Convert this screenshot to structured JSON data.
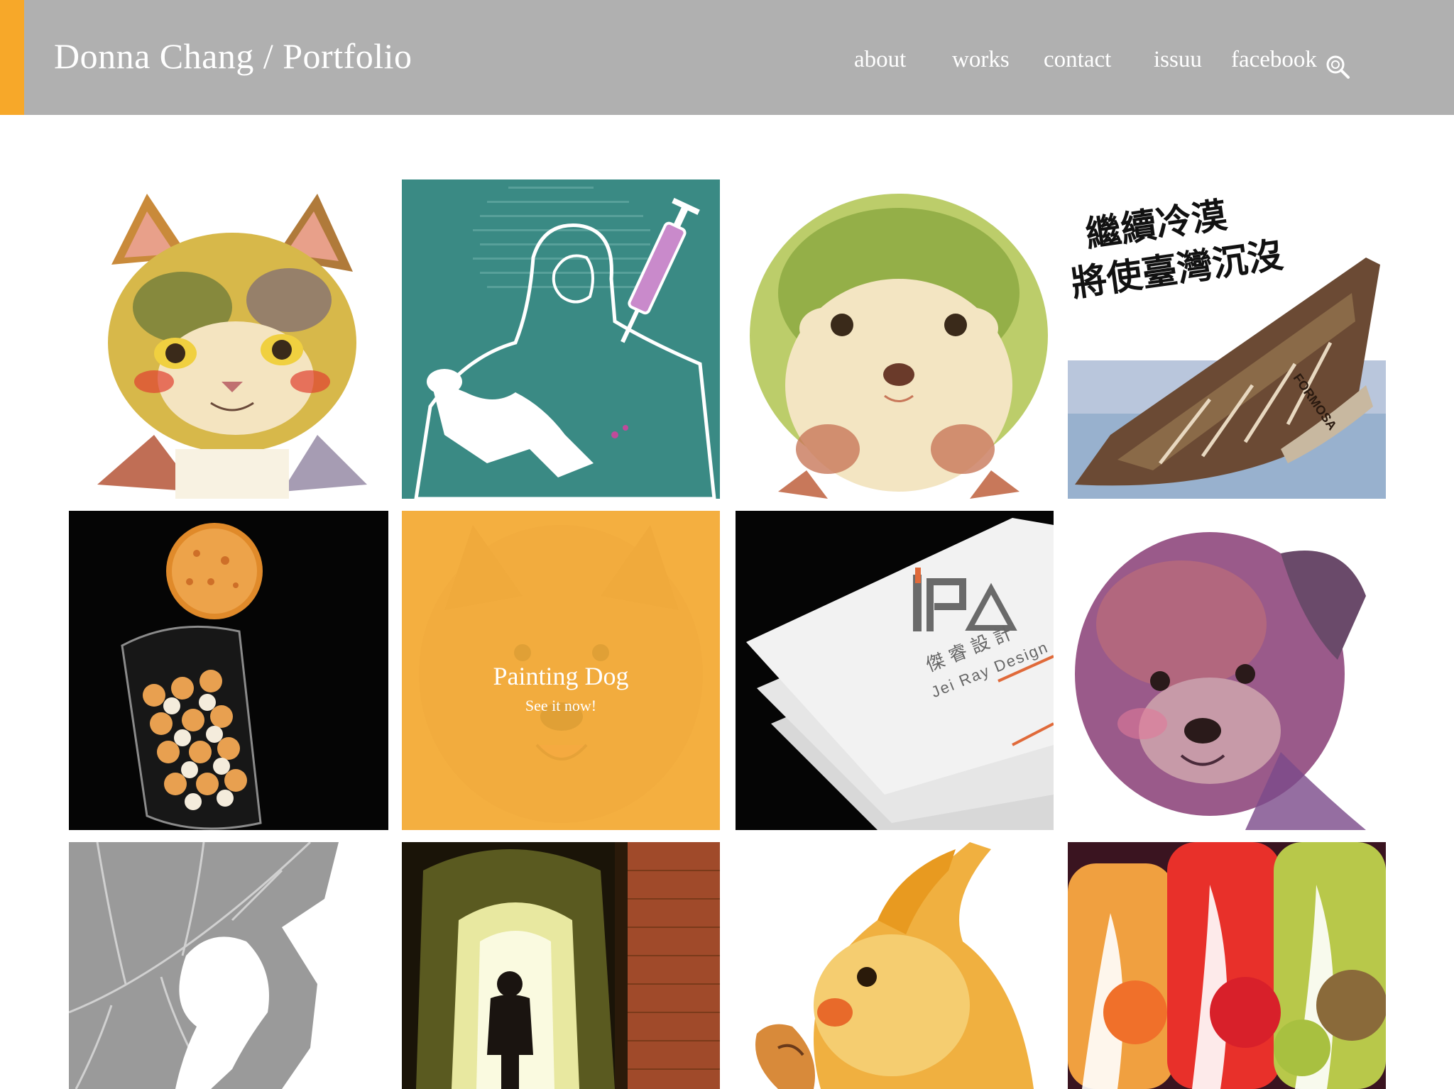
{
  "site": {
    "title": "Donna Chang / Portfolio",
    "accent_color": "#f7a829",
    "header_color": "#b0b0b0"
  },
  "nav": {
    "items": [
      {
        "label": "about"
      },
      {
        "label": "works"
      },
      {
        "label": "contact"
      },
      {
        "label": "issuu"
      },
      {
        "label": "facebook"
      }
    ],
    "search_icon": "search-icon"
  },
  "works": {
    "tiles": [
      {
        "name": "watercolor-cat",
        "subject": "cat"
      },
      {
        "name": "euthanasia-poster",
        "subject": "woman-with-dog-and-syringe"
      },
      {
        "name": "watercolor-hedgehog",
        "subject": "hedgehog"
      },
      {
        "name": "formosa-boat-poster",
        "subject": "sinking-boat",
        "headline_line1": "繼續冷漠",
        "headline_line2": "將使臺灣沉沒",
        "boat_label": "FORMOSA"
      },
      {
        "name": "rice-cracker-jar",
        "subject": "snack-jar"
      },
      {
        "name": "painting-dog",
        "subject": "dog",
        "overlay_title": "Painting Dog",
        "overlay_link": "See it now!"
      },
      {
        "name": "jei-ray-business-cards",
        "subject": "business-cards",
        "brand_chinese": "傑睿設計",
        "brand_english": "Jei Ray Design"
      },
      {
        "name": "watercolor-puppy",
        "subject": "puppy"
      },
      {
        "name": "leaf-taiwan-map",
        "subject": "leaf"
      },
      {
        "name": "corridor-photo",
        "subject": "corridor"
      },
      {
        "name": "watercolor-cockatiel",
        "subject": "cockatiel"
      },
      {
        "name": "juice-bottles",
        "subject": "bottles"
      }
    ]
  }
}
